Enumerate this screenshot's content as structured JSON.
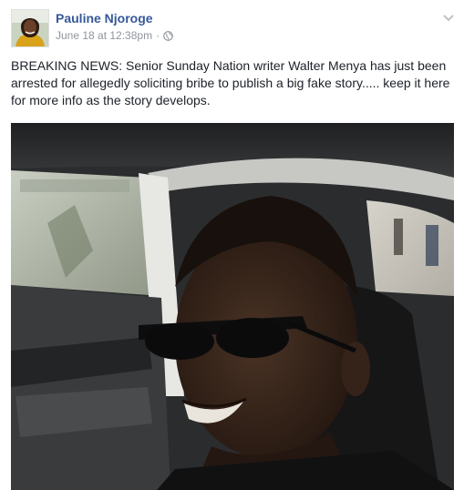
{
  "post": {
    "author": "Pauline Njoroge",
    "timestamp": "June 18 at 12:38pm",
    "separator": "·",
    "privacy_icon": "globe-icon",
    "menu_icon": "chevron-down-icon",
    "text": "BREAKING NEWS: Senior Sunday Nation writer Walter Menya has just been arrested for allegedly soliciting bribe to publish a big fake story..... keep it here for more info as the story develops."
  },
  "colors": {
    "author_link": "#365899",
    "meta_text": "#90949c",
    "body_text": "#1d2129"
  }
}
